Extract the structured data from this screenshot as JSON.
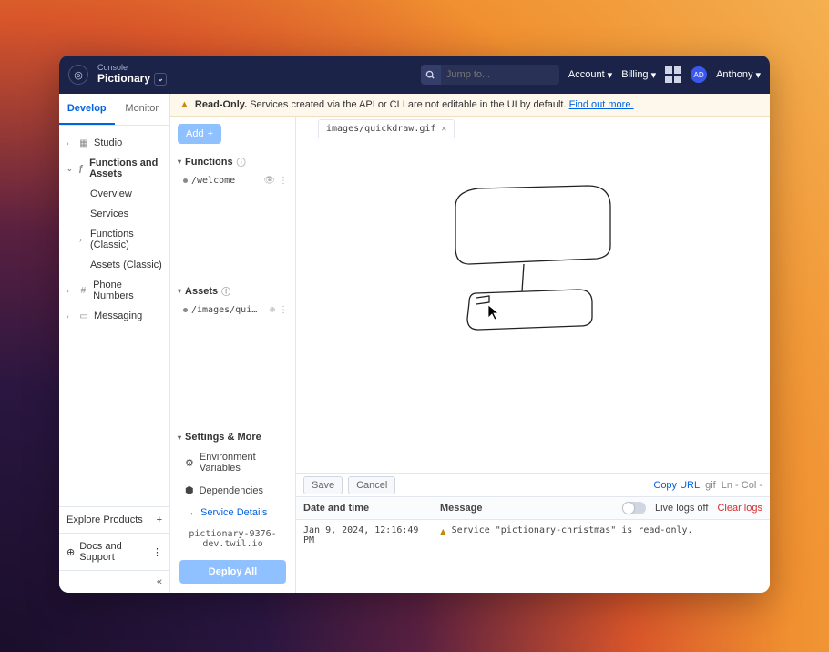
{
  "topbar": {
    "product_sub": "Console",
    "product_name": "Pictionary",
    "search_placeholder": "Jump to...",
    "account_label": "Account",
    "billing_label": "Billing",
    "user_initials": "AD",
    "user_name": "Anthony"
  },
  "tabs": {
    "develop": "Develop",
    "monitor": "Monitor"
  },
  "nav": {
    "studio": "Studio",
    "fa": "Functions and Assets",
    "overview": "Overview",
    "services": "Services",
    "functions_classic": "Functions (Classic)",
    "assets_classic": "Assets (Classic)",
    "phone": "Phone Numbers",
    "messaging": "Messaging",
    "explore": "Explore Products",
    "docs": "Docs and Support"
  },
  "banner": {
    "bold": "Read-Only.",
    "text": "Services created via the API or CLI are not editable in the UI by default.",
    "link": "Find out more."
  },
  "panel": {
    "add": "Add",
    "functions": "Functions",
    "func_file": "/welcome",
    "assets": "Assets",
    "asset_file": "/images/qui…",
    "settings_more": "Settings & More",
    "env_vars": "Environment Variables",
    "deps": "Dependencies",
    "service_details": "Service Details",
    "domain": "pictionary-9376-dev.twil.io",
    "deploy": "Deploy All"
  },
  "editor": {
    "tab_name": "images/quickdraw.gif",
    "save": "Save",
    "cancel": "Cancel",
    "copy_url": "Copy URL",
    "lang": "gif",
    "pos": "Ln - Col -"
  },
  "logs": {
    "date_head": "Date and time",
    "msg_head": "Message",
    "live_label": "Live logs off",
    "clear": "Clear logs",
    "entry_date": "Jan 9, 2024, 12:16:49 PM",
    "entry_msg": "Service \"pictionary-christmas\" is read-only."
  }
}
